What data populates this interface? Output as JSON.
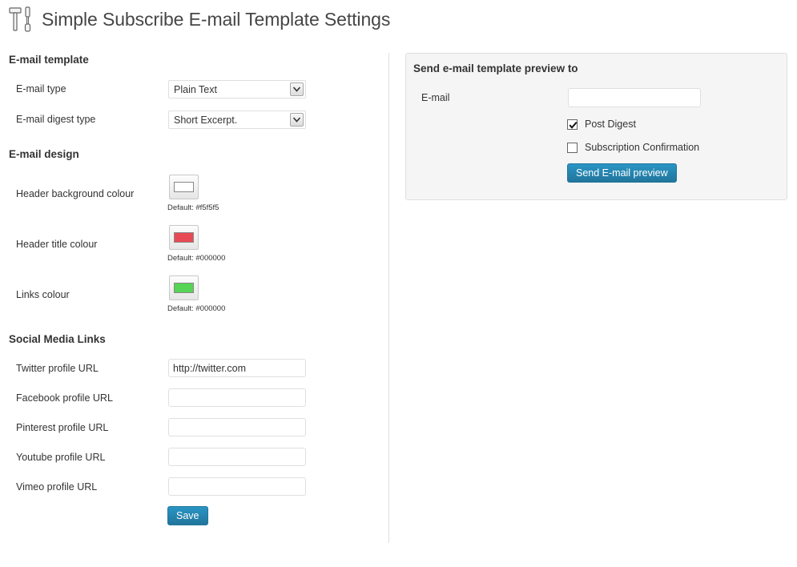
{
  "page": {
    "title": "Simple Subscribe E-mail Template Settings",
    "title_icon": "tools-icon"
  },
  "email_template": {
    "heading": "E-mail template",
    "email_type_label": "E-mail type",
    "email_type_value": "Plain Text",
    "digest_type_label": "E-mail digest type",
    "digest_type_value": "Short Excerpt."
  },
  "email_design": {
    "heading": "E-mail design",
    "colors": [
      {
        "label": "Header background colour",
        "swatch": "#ffffff",
        "default_text": "Default: #f5f5f5"
      },
      {
        "label": "Header title colour",
        "swatch": "#e84a55",
        "default_text": "Default: #000000"
      },
      {
        "label": "Links colour",
        "swatch": "#55d455",
        "default_text": "Default: #000000"
      }
    ]
  },
  "social": {
    "heading": "Social Media Links",
    "fields": [
      {
        "label": "Twitter profile URL",
        "value": "http://twitter.com"
      },
      {
        "label": "Facebook profile URL",
        "value": ""
      },
      {
        "label": "Pinterest profile URL",
        "value": ""
      },
      {
        "label": "Youtube profile URL",
        "value": ""
      },
      {
        "label": "Vimeo profile URL",
        "value": ""
      }
    ],
    "save_label": "Save"
  },
  "preview": {
    "heading": "Send e-mail template preview to",
    "email_label": "E-mail",
    "email_value": "",
    "options": [
      {
        "label": "Post Digest",
        "checked": true
      },
      {
        "label": "Subscription Confirmation",
        "checked": false
      }
    ],
    "send_label": "Send E-mail preview"
  },
  "colors": {
    "button_primary": "#21759b",
    "panel_bg": "#f5f5f5",
    "border": "#dfdfdf"
  }
}
